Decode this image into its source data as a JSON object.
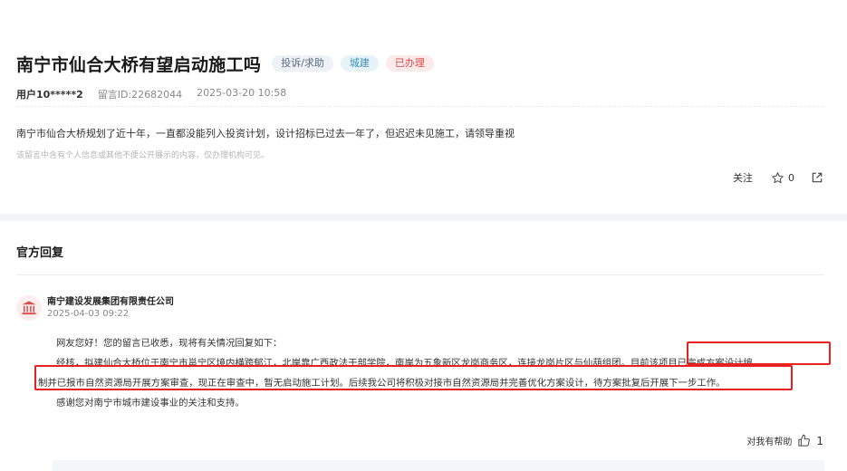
{
  "post": {
    "title": "南宁市仙合大桥有望启动施工吗",
    "tags": {
      "type": "投诉/求助",
      "category": "城建",
      "status": "已办理"
    },
    "user": "用户10*****2",
    "message_id": "留言ID:22682044",
    "time": "2025-03-20 10:58",
    "content": "南宁市仙合大桥规划了近十年，一直都没能列入投资计划，设计招标已过去一年了，但迟迟未见施工，请领导重视",
    "privacy_note": "该留言中含有个人信息或其他不便公开展示的内容，仅办理机构可见。",
    "follow_label": "关注",
    "star_count": "0"
  },
  "reply": {
    "heading": "官方回复",
    "org_name": "南宁建设发展集团有限责任公司",
    "date": "2025-04-03 09:22",
    "lines": [
      "网友您好！您的留言已收悉，现将有关情况回复如下：",
      "经核，拟建仙合大桥位于南宁市邕宁区境内横跨郁江，北岸靠广西政法干部学院，南岸为五象新区龙岗商务区，连接龙岗片区与仙葫组团。目前该项目已完成方案设计编",
      "制并已报市自然资源局开展方案审查，现正在审查中，暂无启动施工计划。后续我公司将积极对接市自然资源局并完善优化方案设计，待方案批复后开展下一步工作。",
      "感谢您对南宁市城市建设事业的关注和支持。"
    ],
    "helpful_label": "对我有帮助",
    "helpful_count": "1"
  },
  "colors": {
    "status_red": "#d94a4a",
    "highlight_red": "#e8201e",
    "category_blue": "#3b8fb3"
  }
}
